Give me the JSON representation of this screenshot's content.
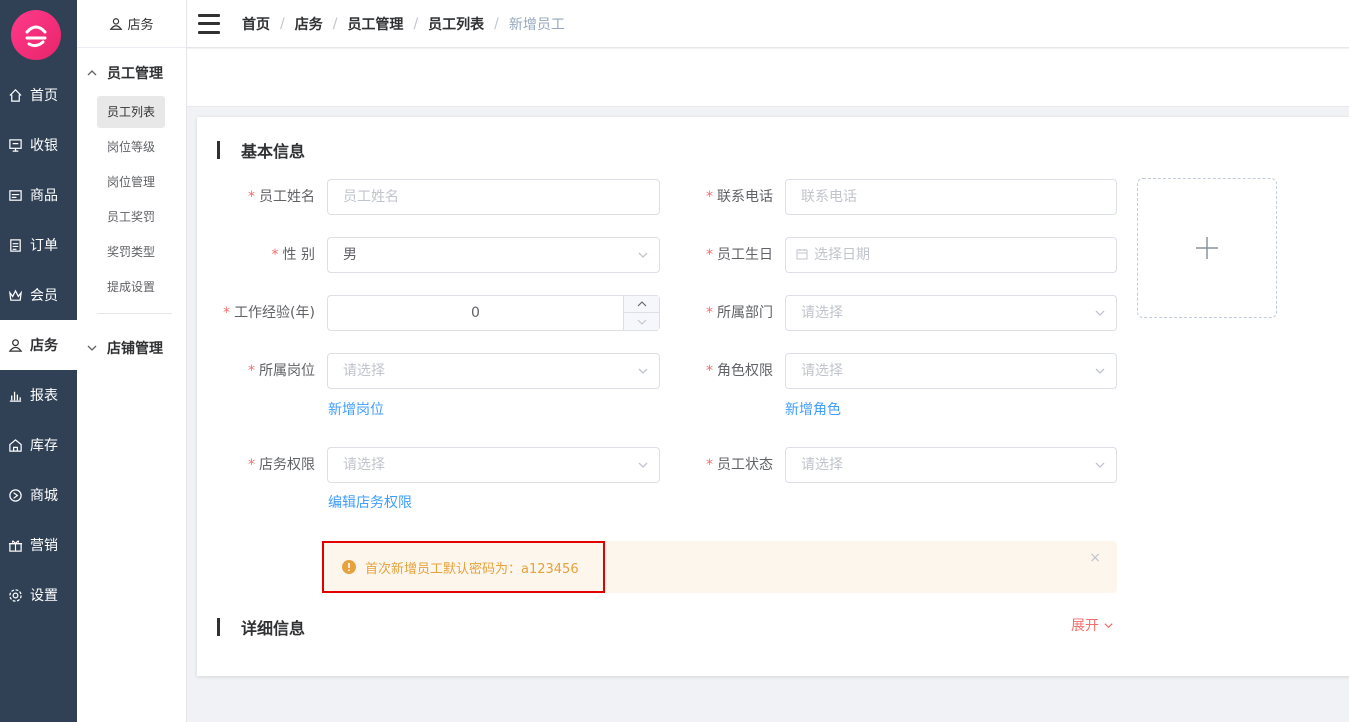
{
  "rail": {
    "items": [
      {
        "label": "首页",
        "icon": "home-icon"
      },
      {
        "label": "收银",
        "icon": "cashier-icon"
      },
      {
        "label": "商品",
        "icon": "goods-icon"
      },
      {
        "label": "订单",
        "icon": "order-icon"
      },
      {
        "label": "会员",
        "icon": "crown-icon"
      },
      {
        "label": "店务",
        "icon": "staff-icon"
      },
      {
        "label": "报表",
        "icon": "chart-icon"
      },
      {
        "label": "库存",
        "icon": "warehouse-icon"
      },
      {
        "label": "商城",
        "icon": "mall-icon"
      },
      {
        "label": "营销",
        "icon": "gift-icon"
      },
      {
        "label": "设置",
        "icon": "gear-icon"
      }
    ]
  },
  "subnav": {
    "head": "店务",
    "group1": "员工管理",
    "items": [
      "员工列表",
      "岗位等级",
      "岗位管理",
      "员工奖罚",
      "奖罚类型",
      "提成设置"
    ],
    "group2": "店铺管理"
  },
  "breadcrumb": {
    "items": [
      "首页",
      "店务",
      "员工管理",
      "员工列表",
      "新增员工"
    ]
  },
  "form": {
    "section_basic": "基本信息",
    "section_detail": "详细信息",
    "expand_label": "展开",
    "name_label": "员工姓名",
    "name_placeholder": "员工姓名",
    "phone_label": "联系电话",
    "phone_placeholder": "联系电话",
    "gender_label": "性 别",
    "gender_value": "男",
    "birthday_label": "员工生日",
    "birthday_placeholder": "选择日期",
    "experience_label": "工作经验(年)",
    "experience_value": "0",
    "department_label": "所属部门",
    "department_placeholder": "请选择",
    "position_label": "所属岗位",
    "position_placeholder": "请选择",
    "add_position_link": "新增岗位",
    "role_label": "角色权限",
    "role_placeholder": "请选择",
    "add_role_link": "新增角色",
    "store_perm_label": "店务权限",
    "store_perm_placeholder": "请选择",
    "edit_store_perm_link": "编辑店务权限",
    "status_label": "员工状态",
    "status_placeholder": "请选择",
    "alert_text": "首次新增员工默认密码为：a123456",
    "alert_close": "×"
  },
  "colors": {
    "rail_bg": "#304156",
    "required": "#f56c6c",
    "link": "#409eff",
    "alert_bg": "#fdf6ec",
    "alert_text": "#e6a23c",
    "highlight": "#e00000"
  }
}
